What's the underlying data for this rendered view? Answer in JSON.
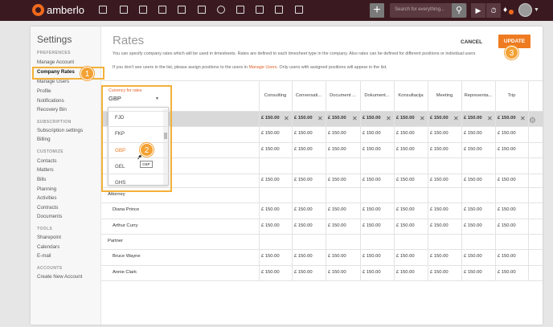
{
  "app": {
    "name": "amberlo",
    "search_placeholder": "Search for everything...",
    "timer_icon": "stopwatch-icon",
    "play_icon": "play-icon",
    "bell_icon": "bell-icon",
    "brand_color": "#3a1a20",
    "accent_color": "#ef7b21"
  },
  "sidebar": {
    "title": "Settings",
    "sections": [
      {
        "label": "PREFERENCES",
        "items": [
          "Manage Account",
          "Company Rates",
          "Manage Users",
          "Profile",
          "Notifications",
          "Recovery Bin"
        ]
      },
      {
        "label": "SUBSCRIPTION",
        "items": [
          "Subscription settings",
          "Billing"
        ]
      },
      {
        "label": "CUSTOMIZE",
        "items": [
          "Contacts",
          "Matters",
          "Bills",
          "Planning",
          "Activities",
          "Contracts",
          "Documents"
        ]
      },
      {
        "label": "TOOLS",
        "items": [
          "Sharepoint",
          "Calendars",
          "E-mail"
        ]
      },
      {
        "label": "ACCOUNTS",
        "items": [
          "Create New Account"
        ]
      }
    ],
    "active": "Company Rates"
  },
  "main": {
    "title": "Rates",
    "desc1": "You can specify company rates which will be used in timesheets. Rates are defined to each timesheet type in the company. Also rates can be defined for different positions or individual users",
    "desc2_pre": "If you don't see users in the list, please assign positions to the users in ",
    "desc2_link": "Manage Users",
    "desc2_post": ". Only users with assigned positions will appear in the list.",
    "cancel": "CANCEL",
    "update": "UPDATE"
  },
  "currency": {
    "label": "Currency for rates",
    "value": "GBP",
    "options": [
      "FJD",
      "FKP",
      "GBP",
      "GEL",
      "GHS"
    ],
    "selected": "GBP",
    "tooltip": "GBP"
  },
  "table": {
    "columns": [
      "Consulting",
      "Conversati...",
      "Document ...",
      "Dokument...",
      "Konsultacija",
      "Meeting",
      "Representa...",
      "Trip"
    ],
    "default_rate": "£ 150.00",
    "rows": [
      {
        "label": "",
        "type": "default"
      },
      {
        "label": "",
        "type": "user"
      },
      {
        "label": "",
        "type": "user"
      },
      {
        "label": "",
        "type": "group"
      },
      {
        "label": "",
        "type": "user"
      },
      {
        "label": "Attorney",
        "type": "group"
      },
      {
        "label": "Diana Prince",
        "type": "user"
      },
      {
        "label": "Arthur Curry",
        "type": "user"
      },
      {
        "label": "Partner",
        "type": "group"
      },
      {
        "label": "Bruce Wayne",
        "type": "user"
      },
      {
        "label": "Annie Clark",
        "type": "user"
      }
    ]
  },
  "badges": {
    "b1": "1",
    "b2": "2",
    "b3": "3"
  }
}
